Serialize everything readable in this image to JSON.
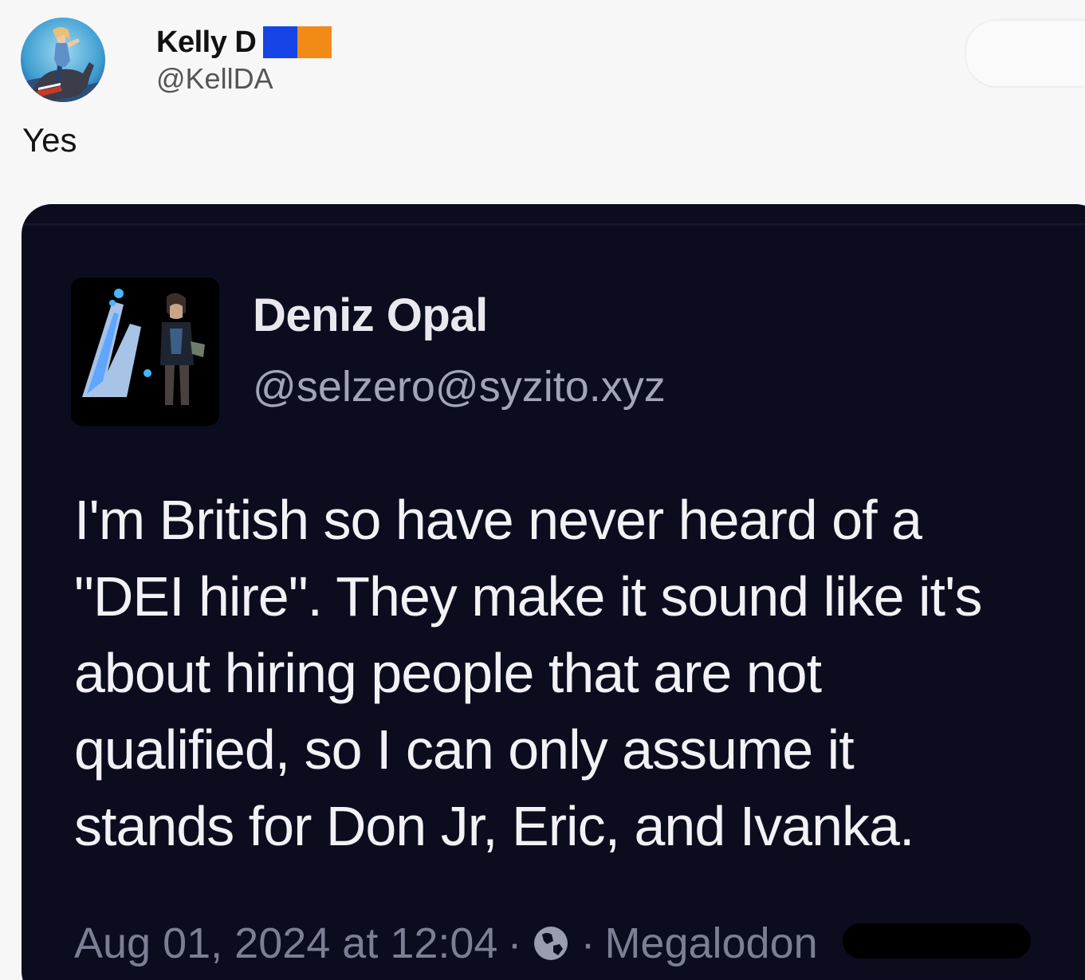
{
  "post": {
    "author_name": "Kelly D",
    "author_handle": "@KellDA",
    "text": "Yes",
    "flag_colors": [
      "#1744e6",
      "#f28a17"
    ],
    "avatar_icon": "woman-on-donkey-avatar"
  },
  "embedded_post": {
    "author_name": "Deniz Opal",
    "author_handle": "@selzero@syzito.xyz",
    "avatar_icon": "character-logo-avatar",
    "body_lines": [
      "I'm British so have never heard of a",
      "\"DEI hire\". They make it sound like it's",
      "about hiring people that are not",
      "qualified, so I can only assume it",
      "stands for Don Jr, Eric, and Ivanka."
    ],
    "timestamp": "Aug 01, 2024 at 12:04",
    "separator": "·",
    "visibility_icon": "globe-icon",
    "client": "Megalodon"
  },
  "colors": {
    "embed_background": "#0b0c1e",
    "embed_text": "#f2f2f6",
    "embed_meta": "#7c7f94"
  }
}
